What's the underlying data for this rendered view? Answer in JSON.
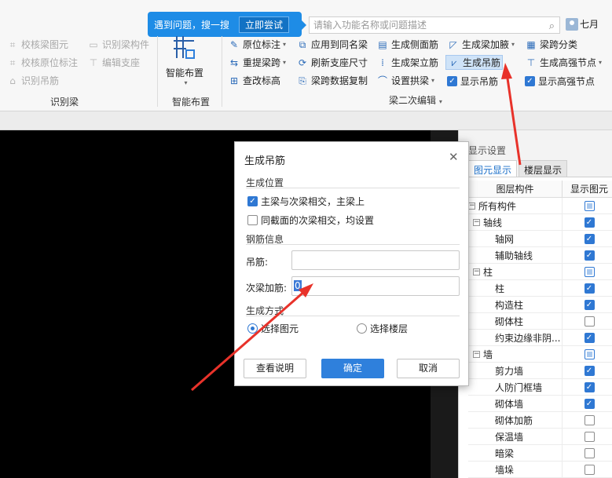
{
  "tip": {
    "text": "遇到问题，搜一搜",
    "button": "立即尝试"
  },
  "search": {
    "placeholder": "请输入功能名称或问题描述"
  },
  "user": {
    "name": "七月"
  },
  "ribbon": {
    "identify_group": {
      "items": [
        "校核梁图元",
        "识别梁构件",
        "校核原位标注",
        "编辑支座",
        "识别吊筋"
      ],
      "label": "识别梁"
    },
    "smart_group": {
      "button": "智能布置",
      "label": "智能布置"
    },
    "edit_group": {
      "col1": [
        "原位标注",
        "重提梁跨",
        "查改标高"
      ],
      "col2": [
        "应用到同名梁",
        "刷新支座尺寸",
        "梁跨数据复制"
      ],
      "col3": [
        "生成侧面筋",
        "生成架立筋",
        "设置拱梁"
      ],
      "col4": [
        "生成梁加腋",
        "生成吊筋",
        "显示吊筋"
      ],
      "col5": [
        "梁跨分类",
        "生成高强节点",
        "显示高强节点"
      ],
      "label": "梁二次编辑"
    }
  },
  "right_panel": {
    "title": "显示设置",
    "tabs": [
      "图元显示",
      "楼层显示"
    ],
    "col_layer": "图层构件",
    "col_show": "显示图元",
    "rows": [
      {
        "label": "所有构件",
        "state": "part"
      },
      {
        "label": "轴线",
        "state": "on"
      },
      {
        "label": "轴网",
        "state": "on"
      },
      {
        "label": "辅助轴线",
        "state": "on"
      },
      {
        "label": "柱",
        "state": "part"
      },
      {
        "label": "柱",
        "state": "on"
      },
      {
        "label": "构造柱",
        "state": "on"
      },
      {
        "label": "砌体柱",
        "state": "off"
      },
      {
        "label": "约束边缘非阴...",
        "state": "on"
      },
      {
        "label": "墙",
        "state": "part"
      },
      {
        "label": "剪力墙",
        "state": "on"
      },
      {
        "label": "人防门框墙",
        "state": "on"
      },
      {
        "label": "砌体墙",
        "state": "on"
      },
      {
        "label": "砌体加筋",
        "state": "off"
      },
      {
        "label": "保温墙",
        "state": "off"
      },
      {
        "label": "暗梁",
        "state": "off"
      },
      {
        "label": "墙垛",
        "state": "off"
      }
    ]
  },
  "dialog": {
    "title": "生成吊筋",
    "section_position": "生成位置",
    "opt_main_secondary": "主梁与次梁相交，主梁上",
    "opt_main_secondary_checked": true,
    "opt_same_section": "同截面的次梁相交，均设置",
    "opt_same_section_checked": false,
    "section_rebar": "钢筋信息",
    "field_hanger_label": "吊筋:",
    "field_hanger_value": "",
    "field_secondary_label": "次梁加筋:",
    "field_secondary_value": "0",
    "section_method": "生成方式",
    "radio_element": "选择图元",
    "radio_floor": "选择楼层",
    "selected_method": "选择图元",
    "btn_help": "查看说明",
    "btn_ok": "确定",
    "btn_cancel": "取消"
  }
}
